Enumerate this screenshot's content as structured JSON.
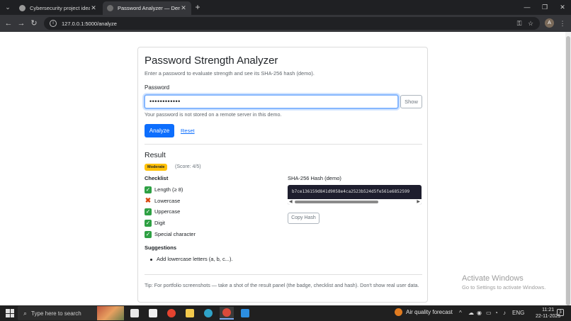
{
  "browser": {
    "tabs": [
      {
        "title": "Cybersecurity project ideas"
      },
      {
        "title": "Password Analyzer — Demo"
      }
    ],
    "url": "127.0.0.1:5000/analyze",
    "profile_initial": "A"
  },
  "app": {
    "title": "Password Strength Analyzer",
    "subtitle": "Enter a password to evaluate strength and see its SHA-256 hash (demo).",
    "password_label": "Password",
    "password_value": "••••••••••••",
    "show_label": "Show",
    "privacy_note": "Your password is not stored on a remote server in this demo.",
    "analyze_label": "Analyze",
    "reset_label": "Reset"
  },
  "result": {
    "heading": "Result",
    "badge": "Moderate",
    "score": "(Score: 4/5)",
    "checklist_heading": "Checklist",
    "checklist": [
      {
        "label": "Length (≥ 8)",
        "passed": true
      },
      {
        "label": "Lowercase",
        "passed": false
      },
      {
        "label": "Uppercase",
        "passed": true
      },
      {
        "label": "Digit",
        "passed": true
      },
      {
        "label": "Special character",
        "passed": true
      }
    ],
    "suggestions_heading": "Suggestions",
    "suggestions": [
      "Add lowercase letters (a, b, c...)."
    ],
    "hash_heading": "SHA-256 Hash (demo)",
    "hash_value": "b7ce136159d841d9058e4ca2523b524d5fe561e6852599",
    "copy_label": "Copy Hash",
    "tip": "Tip: For portfolio screenshots — take a shot of the result panel (the badge, checklist and hash). Don't show real user data."
  },
  "watermark": {
    "line1": "Activate Windows",
    "line2": "Go to Settings to activate Windows."
  },
  "taskbar": {
    "search_placeholder": "Type here to search",
    "air_quality": "Air quality forecast",
    "language": "ENG",
    "time": "11:21",
    "date": "22-11-2025",
    "notification_count": "3"
  },
  "colors": {
    "accent": "#0d6efd",
    "badge": "#ffc107",
    "check_ok": "#2ea043",
    "check_fail": "#d9480f",
    "hash_bg": "#1e1e2e"
  }
}
